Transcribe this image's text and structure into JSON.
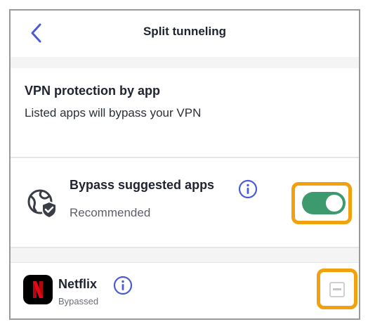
{
  "header": {
    "title": "Split tunneling"
  },
  "intro": {
    "title": "VPN protection by app",
    "subtitle": "Listed apps will bypass your VPN"
  },
  "bypass": {
    "title": "Bypass suggested apps",
    "subtitle": "Recommended",
    "toggle_on": true
  },
  "apps": [
    {
      "name": "Netflix",
      "status": "Bypassed",
      "checked": "indeterminate"
    }
  ],
  "colors": {
    "accent": "#4a5bd6",
    "toggle": "#3d9a6e",
    "highlight": "#f1a10e",
    "netflix_red": "#e50914"
  },
  "icons": {
    "back": "chevron-left-icon",
    "globe": "globe-shield-icon",
    "info": "info-icon",
    "netflix": "netflix-logo"
  }
}
